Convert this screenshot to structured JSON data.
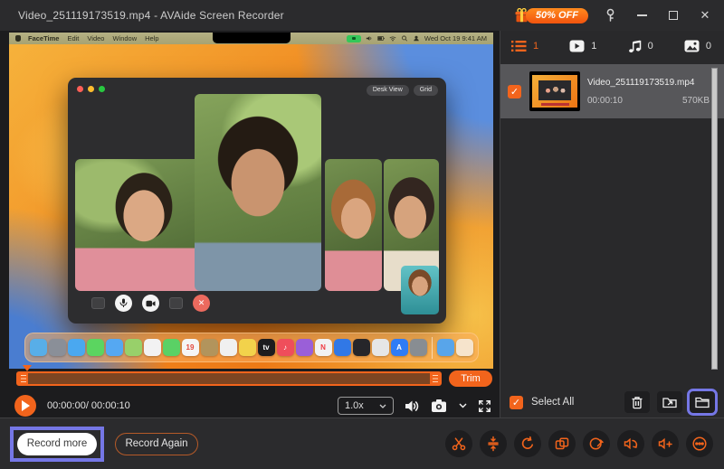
{
  "colors": {
    "accent": "#f2641c",
    "highlight": "#7577e6",
    "titlebar_bg": "#2b2b2d",
    "sidebar_bg": "#29292b",
    "selected_item_bg": "#57575a",
    "promo_gradient": [
      "#ff8a1e",
      "#f2540e"
    ]
  },
  "icons": {
    "check": "✓",
    "close": "✕",
    "end_call": "✕"
  },
  "titlebar": {
    "title": "Video_251119173519.mp4  -  AVAide Screen Recorder",
    "promo": "50% OFF"
  },
  "preview": {
    "menubar": {
      "items": [
        "FaceTime",
        "Edit",
        "Video",
        "Window",
        "Help"
      ],
      "clock": "Wed Oct 19  9:41 AM"
    },
    "facetime": {
      "desk_view": "Desk View",
      "grid": "Grid"
    },
    "dock": {
      "icons": [
        {
          "name": "finder",
          "color": "#58aee8"
        },
        {
          "name": "launchpad",
          "color": "#8a8f98"
        },
        {
          "name": "safari",
          "color": "#4aa8f0"
        },
        {
          "name": "messages",
          "color": "#5bd560"
        },
        {
          "name": "mail",
          "color": "#55a8f2"
        },
        {
          "name": "maps",
          "color": "#98d06a"
        },
        {
          "name": "photos",
          "color": "#f2f2f2"
        },
        {
          "name": "facetime",
          "color": "#5ad165"
        },
        {
          "name": "calendar",
          "color": "#f5f5f5",
          "glyph": "19",
          "glyph_color": "#e3483d"
        },
        {
          "name": "notes-folder",
          "color": "#b2945c"
        },
        {
          "name": "reminders",
          "color": "#f0f0f0"
        },
        {
          "name": "notes",
          "color": "#f2d24b"
        },
        {
          "name": "apple-tv",
          "color": "#1c1c1e",
          "glyph": "tv",
          "glyph_color": "#ffffff"
        },
        {
          "name": "music",
          "color": "#ef4e5b",
          "glyph": "♪",
          "glyph_color": "#ffffff"
        },
        {
          "name": "podcasts",
          "color": "#9a5fd8"
        },
        {
          "name": "news",
          "color": "#f2f2f2",
          "glyph": "N",
          "glyph_color": "#ef3b43"
        },
        {
          "name": "photo-booth",
          "color": "#3178e6"
        },
        {
          "name": "stocks",
          "color": "#26262a"
        },
        {
          "name": "textedit",
          "color": "#e6e6e6"
        },
        {
          "name": "app-store",
          "color": "#2f7cf6",
          "glyph": "A",
          "glyph_color": "#ffffff"
        },
        {
          "name": "system-settings",
          "color": "#888d92"
        },
        {
          "name": "divider"
        },
        {
          "name": "downloads",
          "color": "#58a5ea"
        },
        {
          "name": "trash",
          "color": "rgba(245,245,245,0.75)"
        }
      ]
    }
  },
  "player": {
    "time": "00:00:00/ 00:00:10",
    "speed": "1.0x",
    "trim": "Trim"
  },
  "sidebar": {
    "tabs": [
      {
        "name": "recording-list",
        "count": "1"
      },
      {
        "name": "video",
        "count": "1"
      },
      {
        "name": "audio",
        "count": "0"
      },
      {
        "name": "image",
        "count": "0"
      }
    ],
    "file": {
      "name": "Video_251119173519.mp4",
      "duration": "00:00:10",
      "size": "570KB"
    },
    "select_all": "Select All"
  },
  "footer": {
    "record_more": "Record more",
    "record_again": "Record Again"
  }
}
